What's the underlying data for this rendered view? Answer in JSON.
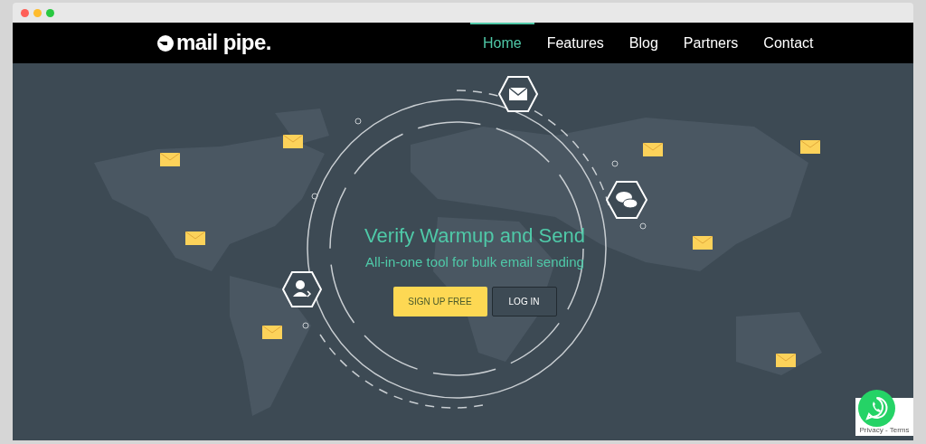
{
  "nav": {
    "logo": "mail pipe.",
    "items": [
      {
        "label": "Home",
        "selected": true
      },
      {
        "label": "Features",
        "selected": false
      },
      {
        "label": "Blog",
        "selected": false
      },
      {
        "label": "Partners",
        "selected": false
      },
      {
        "label": "Contact",
        "selected": false
      }
    ]
  },
  "hero": {
    "title": "Verify Warmup and Send",
    "subtitle": "All-in-one tool for bulk email sending",
    "buttons": [
      {
        "kind": "primary",
        "label": "SIGN UP FREE"
      },
      {
        "kind": "secondary",
        "label": "LOG IN"
      }
    ]
  },
  "recaptcha": {
    "links": "Privacy - Terms"
  }
}
